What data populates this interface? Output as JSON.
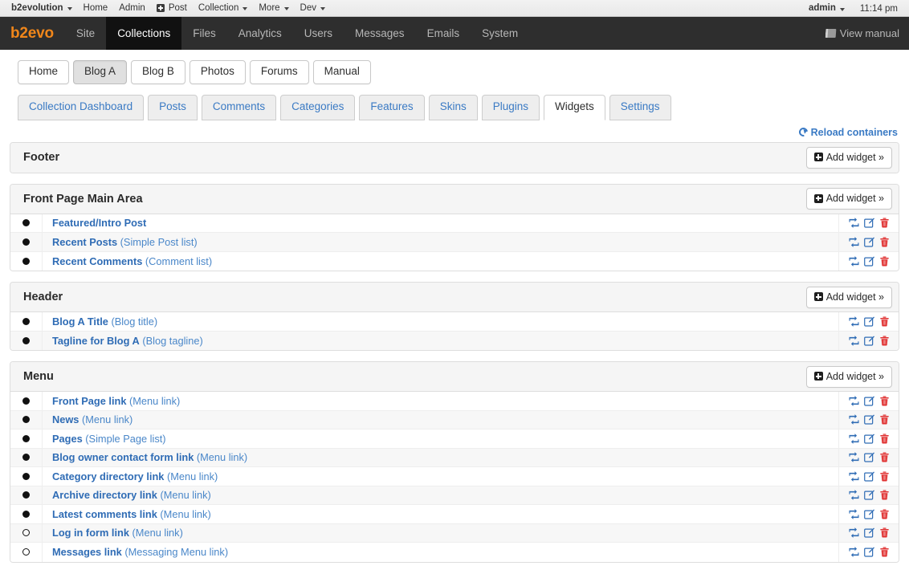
{
  "evobar": {
    "brand": "b2evolution",
    "items": [
      {
        "label": "Home",
        "caret": false,
        "plus": false
      },
      {
        "label": "Admin",
        "caret": false,
        "plus": false
      },
      {
        "label": "Post",
        "caret": false,
        "plus": true
      },
      {
        "label": "Collection",
        "caret": true,
        "plus": false
      },
      {
        "label": "More",
        "caret": true,
        "plus": false
      },
      {
        "label": "Dev",
        "caret": true,
        "plus": false
      }
    ],
    "user": "admin",
    "time": "11:14 pm"
  },
  "mainnav": {
    "logo": "b2evo",
    "tabs": [
      {
        "label": "Site",
        "active": false
      },
      {
        "label": "Collections",
        "active": true
      },
      {
        "label": "Files",
        "active": false
      },
      {
        "label": "Analytics",
        "active": false
      },
      {
        "label": "Users",
        "active": false
      },
      {
        "label": "Messages",
        "active": false
      },
      {
        "label": "Emails",
        "active": false
      },
      {
        "label": "System",
        "active": false
      }
    ],
    "view_manual": "View manual"
  },
  "collection_tabs": [
    {
      "label": "Home",
      "active": false
    },
    {
      "label": "Blog A",
      "active": true
    },
    {
      "label": "Blog B",
      "active": false
    },
    {
      "label": "Photos",
      "active": false
    },
    {
      "label": "Forums",
      "active": false
    },
    {
      "label": "Manual",
      "active": false
    }
  ],
  "sub_tabs": [
    {
      "label": "Collection Dashboard",
      "active": false
    },
    {
      "label": "Posts",
      "active": false
    },
    {
      "label": "Comments",
      "active": false
    },
    {
      "label": "Categories",
      "active": false
    },
    {
      "label": "Features",
      "active": false
    },
    {
      "label": "Skins",
      "active": false
    },
    {
      "label": "Plugins",
      "active": false
    },
    {
      "label": "Widgets",
      "active": true
    },
    {
      "label": "Settings",
      "active": false
    }
  ],
  "toolbar": {
    "reload_containers": "Reload containers",
    "add_widget": "Add widget »"
  },
  "colors": {
    "accent_orange": "#f0861a",
    "link_blue": "#2f6cb5",
    "type_blue": "#4a87c9",
    "delete_red": "#e03131",
    "nav_dark": "#2e2e2e",
    "nav_active": "#111111"
  },
  "icons": {
    "move": "move-widget-icon",
    "edit": "edit-widget-icon",
    "delete": "delete-widget-icon"
  },
  "containers": [
    {
      "title": "Footer",
      "widgets": []
    },
    {
      "title": "Front Page Main Area",
      "widgets": [
        {
          "name": "Featured/Intro Post",
          "type": "",
          "enabled": true
        },
        {
          "name": "Recent Posts",
          "type": "(Simple Post list)",
          "enabled": true
        },
        {
          "name": "Recent Comments",
          "type": "(Comment list)",
          "enabled": true
        }
      ]
    },
    {
      "title": "Header",
      "widgets": [
        {
          "name": "Blog A Title",
          "type": "(Blog title)",
          "enabled": true
        },
        {
          "name": "Tagline for Blog A",
          "type": "(Blog tagline)",
          "enabled": true
        }
      ]
    },
    {
      "title": "Menu",
      "widgets": [
        {
          "name": "Front Page link",
          "type": "(Menu link)",
          "enabled": true
        },
        {
          "name": "News",
          "type": "(Menu link)",
          "enabled": true
        },
        {
          "name": "Pages",
          "type": "(Simple Page list)",
          "enabled": true
        },
        {
          "name": "Blog owner contact form link",
          "type": "(Menu link)",
          "enabled": true
        },
        {
          "name": "Category directory link",
          "type": "(Menu link)",
          "enabled": true
        },
        {
          "name": "Archive directory link",
          "type": "(Menu link)",
          "enabled": true
        },
        {
          "name": "Latest comments link",
          "type": "(Menu link)",
          "enabled": true
        },
        {
          "name": "Log in form link",
          "type": "(Menu link)",
          "enabled": false
        },
        {
          "name": "Messages link",
          "type": "(Messaging Menu link)",
          "enabled": false
        }
      ]
    }
  ]
}
